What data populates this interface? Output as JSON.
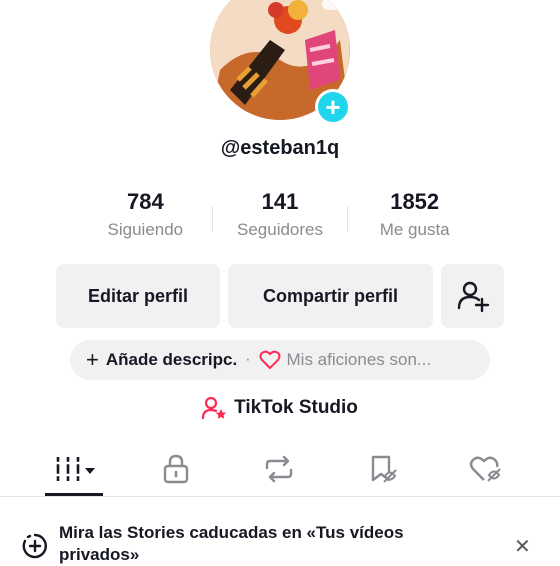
{
  "profile": {
    "username": "@esteban1q",
    "add_avatar_symbol": "+"
  },
  "stats": [
    {
      "value": "784",
      "label": "Siguiendo"
    },
    {
      "value": "141",
      "label": "Seguidores"
    },
    {
      "value": "1852",
      "label": "Me gusta"
    }
  ],
  "actions": {
    "edit_profile": "Editar perfil",
    "share_profile": "Compartir perfil",
    "add_friends_icon": "add-user-icon"
  },
  "chips": {
    "add_bio_symbol": "+",
    "add_bio": "Añade descripc.",
    "separator": "·",
    "hobbies": "Mis aficiones son..."
  },
  "studio": {
    "label": "TikTok Studio"
  },
  "tabs": [
    {
      "icon": "videos-grid-icon",
      "selected": true
    },
    {
      "icon": "lock-icon"
    },
    {
      "icon": "repost-icon"
    },
    {
      "icon": "bookmark-icon"
    },
    {
      "icon": "liked-heart-icon"
    }
  ],
  "banner": {
    "text": "Mira las Stories caducadas en «Tus vídeos privados»",
    "close_symbol": "✕"
  },
  "colors": {
    "accent": "#20d5ec",
    "brand_pink": "#fe2c55",
    "muted": "#8a8b91",
    "chip_bg": "#f1f1f2"
  }
}
